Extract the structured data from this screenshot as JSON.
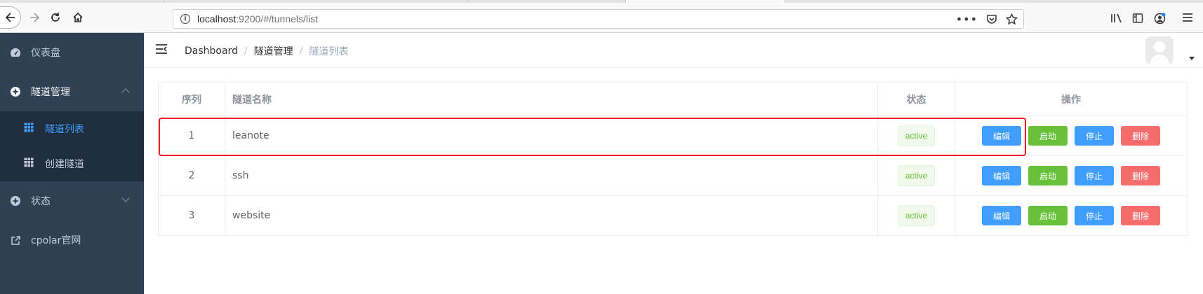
{
  "browser": {
    "url_host": "localhost",
    "url_rest": ":9200/#/tunnels/list",
    "icons": [
      "back-icon",
      "forward-icon",
      "reload-icon",
      "home-icon",
      "info-icon",
      "more-icon",
      "pocket-icon",
      "star-icon",
      "library-icon",
      "sidebar-icon",
      "account-icon",
      "menu-icon"
    ]
  },
  "sidebar": {
    "items": [
      {
        "label": "仪表盘",
        "icon": "dashboard-icon"
      },
      {
        "label": "隧道管理",
        "icon": "compass-icon",
        "expanded": true,
        "children": [
          {
            "label": "隧道列表",
            "icon": "table-icon",
            "active": true
          },
          {
            "label": "创建隧道",
            "icon": "table-icon"
          }
        ]
      },
      {
        "label": "状态",
        "icon": "compass-icon",
        "expanded": false
      },
      {
        "label": "cpolar官网",
        "icon": "external-link-icon"
      }
    ]
  },
  "header": {
    "breadcrumb": [
      "Dashboard",
      "隧道管理",
      "隧道列表"
    ]
  },
  "table": {
    "columns": [
      "序列",
      "隧道名称",
      "状态",
      "操作"
    ],
    "rows": [
      {
        "index": "1",
        "name": "leanote",
        "status": "active"
      },
      {
        "index": "2",
        "name": "ssh",
        "status": "active"
      },
      {
        "index": "3",
        "name": "website",
        "status": "active"
      }
    ],
    "actions": {
      "edit": "编辑",
      "start": "启动",
      "stop": "停止",
      "delete": "删除"
    }
  },
  "colors": {
    "sidebar_bg": "#304156",
    "submenu_bg": "#1f2d3d",
    "accent": "#409eff",
    "success": "#67c23a",
    "danger": "#f56c6c",
    "highlight": "#ee1c25"
  }
}
